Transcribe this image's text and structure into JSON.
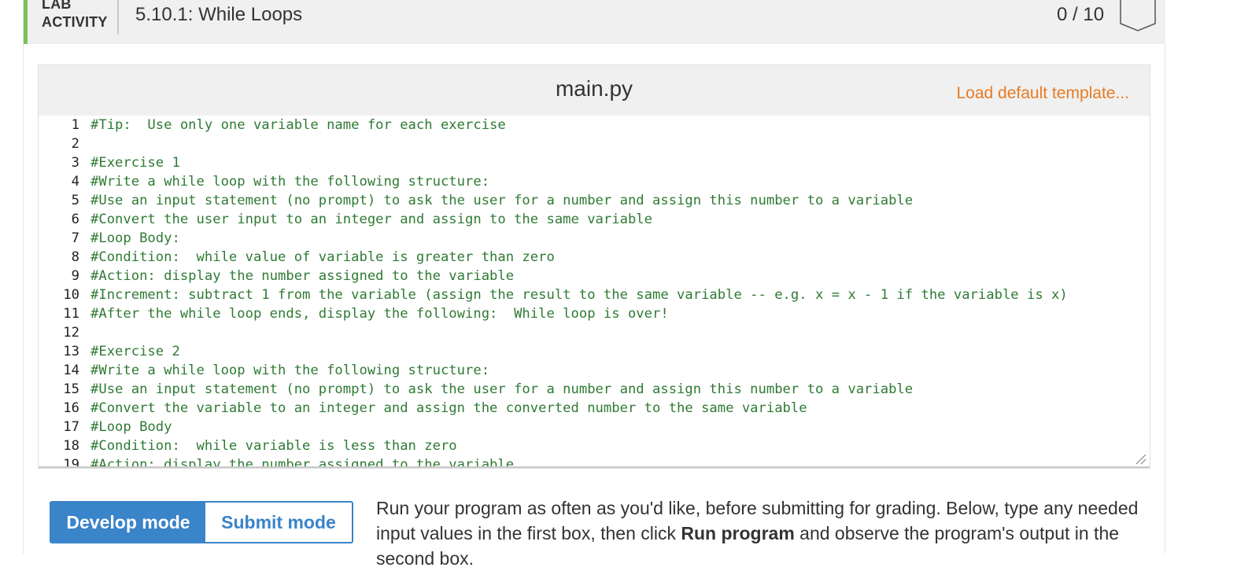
{
  "lab": {
    "label_line1": "LAB",
    "label_line2": "ACTIVITY",
    "title": "5.10.1: While Loops",
    "score": "0 / 10",
    "accent_color": "#7cc05a"
  },
  "editor": {
    "filename": "main.py",
    "load_template": "Load default template...",
    "lines": [
      {
        "n": "1",
        "text": "#Tip:  Use only one variable name for each exercise"
      },
      {
        "n": "2",
        "text": ""
      },
      {
        "n": "3",
        "text": "#Exercise 1"
      },
      {
        "n": "4",
        "text": "#Write a while loop with the following structure:"
      },
      {
        "n": "5",
        "text": "#Use an input statement (no prompt) to ask the user for a number and assign this number to a variable"
      },
      {
        "n": "6",
        "text": "#Convert the user input to an integer and assign to the same variable"
      },
      {
        "n": "7",
        "text": "#Loop Body:"
      },
      {
        "n": "8",
        "text": "#Condition:  while value of variable is greater than zero"
      },
      {
        "n": "9",
        "text": "#Action: display the number assigned to the variable"
      },
      {
        "n": "10",
        "text": "#Increment: subtract 1 from the variable (assign the result to the same variable -- e.g. x = x - 1 if the variable is x)"
      },
      {
        "n": "11",
        "text": "#After the while loop ends, display the following:  While loop is over!"
      },
      {
        "n": "12",
        "text": ""
      },
      {
        "n": "13",
        "text": "#Exercise 2"
      },
      {
        "n": "14",
        "text": "#Write a while loop with the following structure:"
      },
      {
        "n": "15",
        "text": "#Use an input statement (no prompt) to ask the user for a number and assign this number to a variable"
      },
      {
        "n": "16",
        "text": "#Convert the variable to an integer and assign the converted number to the same variable"
      },
      {
        "n": "17",
        "text": "#Loop Body"
      },
      {
        "n": "18",
        "text": "#Condition:  while variable is less than zero"
      },
      {
        "n": "19",
        "text": "#Action: display the number assigned to the variable"
      }
    ]
  },
  "modes": {
    "develop": "Develop mode",
    "submit": "Submit mode",
    "active_color": "#3a84c9"
  },
  "instructions": {
    "part1": "Run your program as often as you'd like, before submitting for grading. Below, type any needed input values in the first box, then click ",
    "bold": "Run program",
    "part2": " and observe the program's output in the second box."
  }
}
